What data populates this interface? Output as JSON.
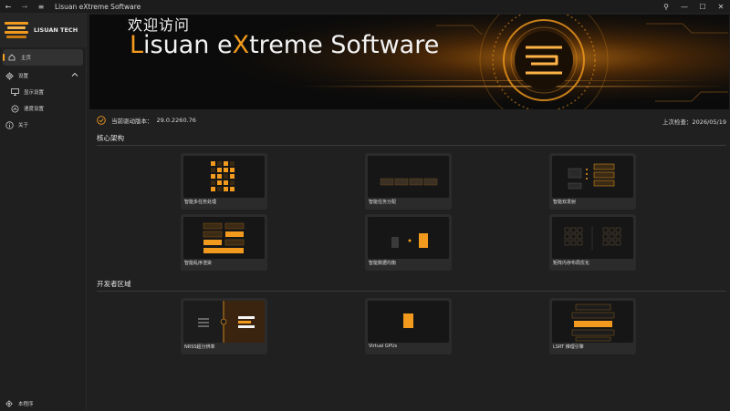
{
  "window": {
    "title": "Lisuan eXtreme Software",
    "back_icon": "back-arrow-icon",
    "forward_icon": "forward-arrow-icon",
    "menu_icon": "hamburger-icon"
  },
  "brand": {
    "name": "LISUAN TECH"
  },
  "sidebar": {
    "items": [
      {
        "label": "主页",
        "icon": "home-icon",
        "active": true
      },
      {
        "label": "设置",
        "icon": "gear-icon",
        "expanded": true
      },
      {
        "label": "显示设置",
        "icon": "monitor-icon",
        "sub": true
      },
      {
        "label": "速度设置",
        "icon": "speedometer-icon",
        "sub": true
      },
      {
        "label": "关于",
        "icon": "info-icon"
      }
    ],
    "bottom": {
      "label": "本程序",
      "icon": "gear-icon"
    }
  },
  "hero": {
    "welcome": "欢迎访问",
    "title_prefix": "L",
    "title_mid1": "isuan e",
    "title_accent": "X",
    "title_rest": "treme Software"
  },
  "status": {
    "driver_label": "当前驱动版本：",
    "driver_version": "29.0.2260.76",
    "last_check_label": "上次检查：",
    "last_check_date": "2026/05/19"
  },
  "sections": {
    "core": {
      "title": "核心架构",
      "cards": [
        {
          "caption": "智能多任务处理"
        },
        {
          "caption": "智能任务分配"
        },
        {
          "caption": "智能双发射"
        },
        {
          "caption": "智能乱序渲染"
        },
        {
          "caption": "智能数据均衡"
        },
        {
          "caption": "矩阵内存布局优化"
        }
      ]
    },
    "dev": {
      "title": "开发者区域",
      "cards": [
        {
          "caption": "NRSS超分辨率"
        },
        {
          "caption": "Virtual GPUs"
        },
        {
          "caption": "LSRT 推理引擎"
        }
      ]
    }
  },
  "colors": {
    "accent": "#f29a1e",
    "background": "#202020",
    "card": "#2b2b2b"
  }
}
